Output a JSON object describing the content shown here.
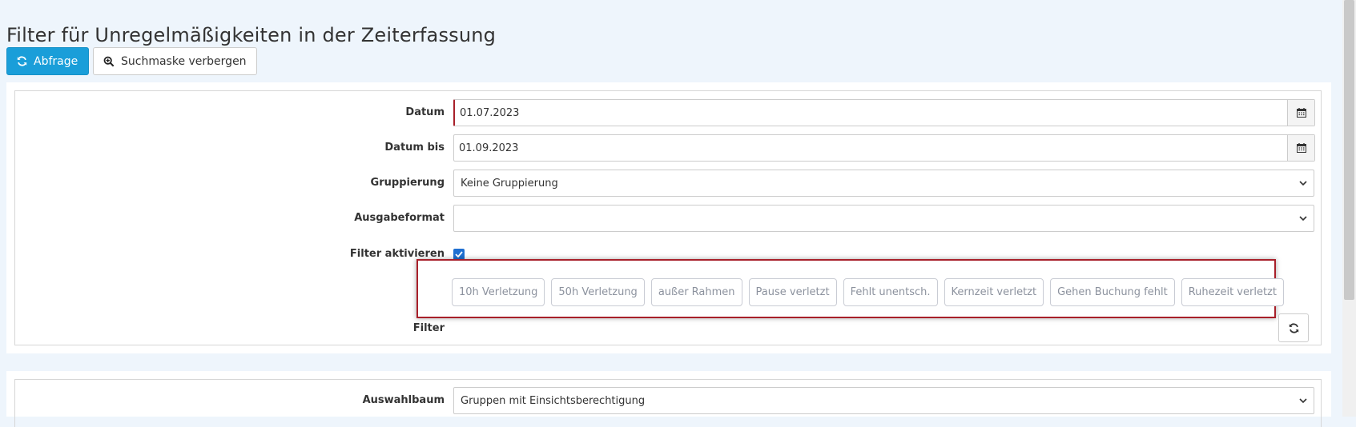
{
  "page": {
    "title": "Filter für Unregelmäßigkeiten in der Zeiterfassung"
  },
  "toolbar": {
    "query_label": "Abfrage",
    "toggle_search_label": "Suchmaske verbergen"
  },
  "form": {
    "date": {
      "label": "Datum",
      "value": "01.07.2023"
    },
    "date_to": {
      "label": "Datum bis",
      "value": "01.09.2023"
    },
    "grouping": {
      "label": "Gruppierung",
      "value": "Keine Gruppierung"
    },
    "output_format": {
      "label": "Ausgabeformat",
      "value": ""
    },
    "filter_active": {
      "label": "Filter aktivieren",
      "checked": true
    },
    "filter": {
      "label": "Filter",
      "chips": [
        "10h Verletzung",
        "50h Verletzung",
        "außer Rahmen",
        "Pause verletzt",
        "Fehlt unentsch.",
        "Kernzeit verletzt",
        "Gehen Buchung fehlt",
        "Ruhezeit verletzt"
      ]
    }
  },
  "form2": {
    "selection_tree": {
      "label": "Auswahlbaum",
      "value": "Gruppen mit Einsichtsberechtigung"
    }
  },
  "colors": {
    "primary": "#1a9ed9",
    "highlight_border": "#a8202a",
    "checkbox": "#1f6fd1",
    "chip_text": "#8c929e"
  },
  "icons": {
    "query": "refresh-icon",
    "toggle_search": "zoom-icon",
    "date_picker": "calendar-icon",
    "select": "chevron-down-icon",
    "filter_refresh": "refresh-icon"
  }
}
